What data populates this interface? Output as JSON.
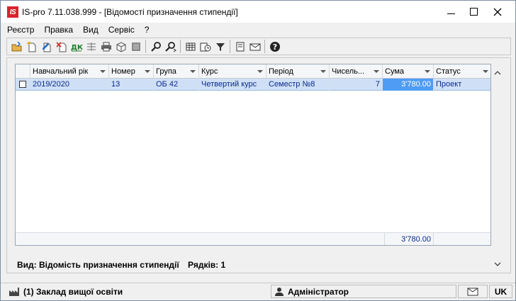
{
  "window": {
    "logo_text": "IS",
    "title": "IS-pro 7.11.038.999 - [Відомості призначення стипендії]"
  },
  "menu": [
    "Реєстр",
    "Правка",
    "Вид",
    "Сервіс",
    "?"
  ],
  "toolbar": {
    "icons": [
      "open-folder-icon",
      "new-document-icon",
      "edit-document-icon",
      "delete-document-icon",
      "debit-credit-icon",
      "ledger-icon",
      "print-icon",
      "package-icon",
      "archive-icon",
      "find-icon",
      "find-next-icon",
      "table-view-icon",
      "history-icon",
      "filter-icon",
      "form-icon",
      "mail-icon",
      "help-icon"
    ]
  },
  "grid": {
    "columns": [
      "Навчальний рік",
      "Номер",
      "Група",
      "Курс",
      "Період",
      "Чисель...",
      "Сума",
      "Статус"
    ],
    "rows": [
      {
        "checked": false,
        "year": "2019/2020",
        "number": "13",
        "group": "ОБ 42",
        "course": "Четвертий курс",
        "period": "Семестр  №8",
        "count": "7",
        "sum": "3'780.00",
        "status": "Проект"
      }
    ],
    "total_sum": "3'780.00"
  },
  "footer": {
    "view_label": "Вид: Відомість призначення стипендії",
    "rows_label": "Рядків: 1"
  },
  "statusbar": {
    "organization": "(1) Заклад вищої освіти",
    "user": "Адміністратор",
    "language": "UK"
  },
  "colors": {
    "selected_row": "#cfe0f6",
    "selected_cell": "#4f9cf5",
    "logo": "#d9232e"
  }
}
